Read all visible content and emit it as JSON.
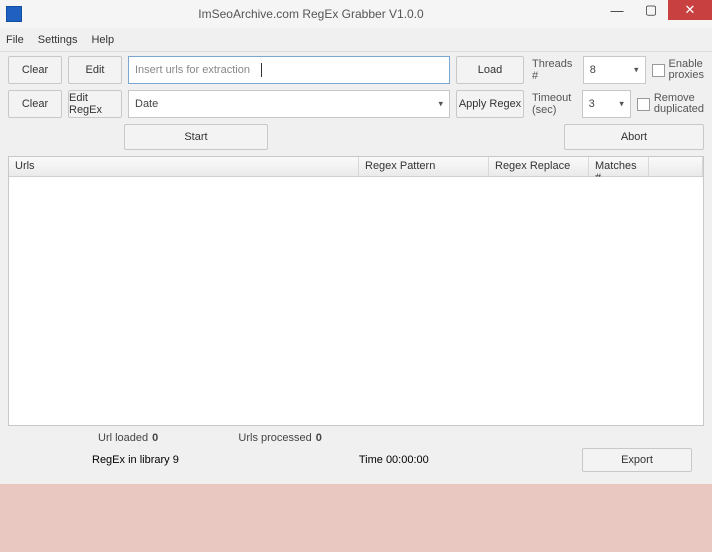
{
  "title": "ImSeoArchive.com RegEx Grabber V1.0.0",
  "menu": {
    "file": "File",
    "settings": "Settings",
    "help": "Help"
  },
  "row1": {
    "clear": "Clear",
    "edit": "Edit",
    "url_placeholder": "Insert urls for extraction",
    "load": "Load",
    "threads_label": "Threads #",
    "threads_value": "8",
    "enable_proxies_l1": "Enable",
    "enable_proxies_l2": "proxies"
  },
  "row2": {
    "clear": "Clear",
    "edit_regex": "Edit RegEx",
    "regex_select": "Date",
    "apply_regex": "Apply Regex",
    "timeout_label": "Timeout (sec)",
    "timeout_value": "3",
    "remove_dup_l1": "Remove",
    "remove_dup_l2": "duplicated"
  },
  "actions": {
    "start": "Start",
    "abort": "Abort",
    "export": "Export"
  },
  "table": {
    "urls": "Urls",
    "pattern": "Regex Pattern",
    "replace": "Regex Replace",
    "matches": "Matches #"
  },
  "status": {
    "url_loaded_l": "Url loaded",
    "url_loaded_v": "0",
    "urls_processed_l": "Urls processed",
    "urls_processed_v": "0",
    "regex_lib_l": "RegEx in library",
    "regex_lib_v": "9",
    "time_l": "Time",
    "time_v": "00:00:00"
  }
}
